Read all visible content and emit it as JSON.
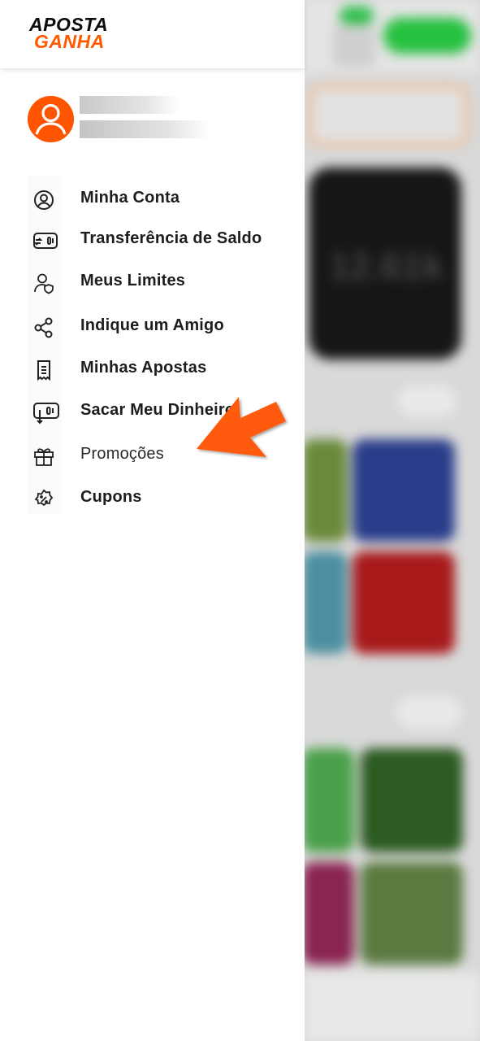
{
  "header": {
    "logo_line1": "APOSTA",
    "logo_line2": "GANHA"
  },
  "menu": {
    "items": [
      {
        "label": "Minha Conta",
        "icon": "account-circle-icon"
      },
      {
        "label": "Transferência de Saldo",
        "icon": "balance-transfer-icon"
      },
      {
        "label": "Meus Limites",
        "icon": "user-limits-icon"
      },
      {
        "label": "Indique um Amigo",
        "icon": "share-icon"
      },
      {
        "label": "Minhas Apostas",
        "icon": "receipt-icon"
      },
      {
        "label": "Sacar Meu Dinheiro",
        "icon": "withdraw-icon"
      },
      {
        "label": "Promoções",
        "icon": "gift-icon"
      },
      {
        "label": "Cupons",
        "icon": "coupon-icon"
      }
    ]
  },
  "background": {
    "balance_text": "12.61k"
  },
  "colors": {
    "brand_orange": "#ff5500",
    "brand_black": "#0b0b0b",
    "accent_green": "#27c241",
    "arrow_orange": "#ff5a0d"
  }
}
